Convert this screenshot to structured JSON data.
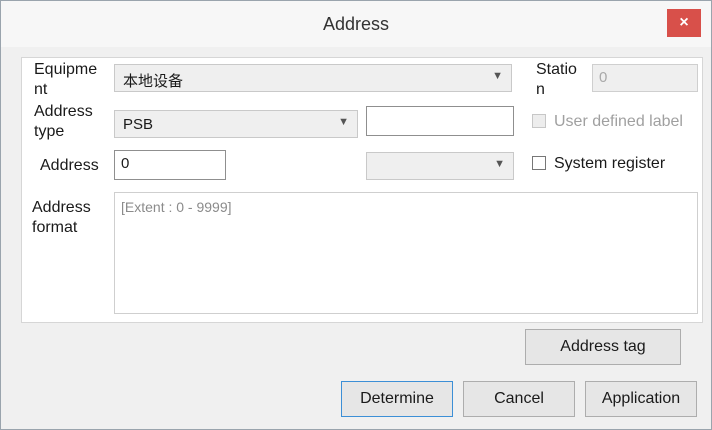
{
  "window": {
    "title": "Address",
    "close_glyph": "×"
  },
  "form": {
    "equipment_label": "Equipme nt",
    "equipment_value": "本地设备",
    "station_label": "Statio n",
    "station_value": "0",
    "address_type_label": "Address type",
    "address_type_value": "PSB",
    "address_type_extra_value": "",
    "user_defined_label": "User defined label",
    "user_defined_checked": false,
    "address_label": "Address",
    "address_value": "0",
    "address_combo_value": "",
    "system_register_label": "System register",
    "system_register_checked": false,
    "address_format_label": "Address format",
    "address_format_hint": "[Extent : 0 - 9999]"
  },
  "buttons": {
    "address_tag": "Address tag",
    "determine": "Determine",
    "cancel": "Cancel",
    "application": "Application"
  },
  "icons": {
    "dropdown": "chevron-down-icon",
    "close": "close-icon"
  },
  "colors": {
    "close_button": "#d8504a",
    "default_button_border": "#3c8fd6"
  }
}
